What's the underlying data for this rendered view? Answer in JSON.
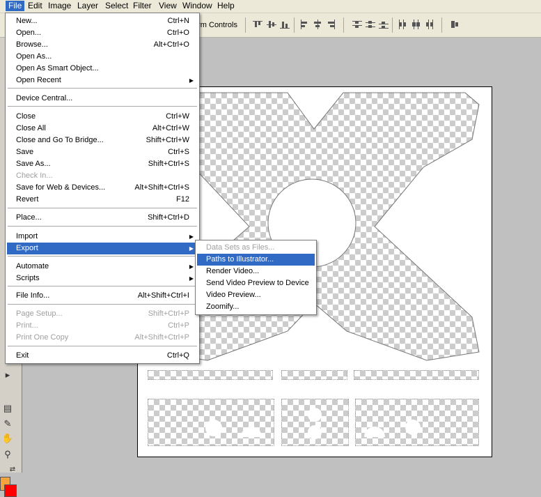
{
  "menubar": {
    "items": [
      {
        "label": "File",
        "active": true
      },
      {
        "label": "Edit"
      },
      {
        "label": "Image"
      },
      {
        "label": "Layer"
      },
      {
        "label": "Select"
      },
      {
        "label": "Filter"
      },
      {
        "label": "View"
      },
      {
        "label": "Window"
      },
      {
        "label": "Help"
      }
    ]
  },
  "options_bar": {
    "transform_controls_label": "orm Controls"
  },
  "file_menu": {
    "items": [
      {
        "label": "New...",
        "shortcut": "Ctrl+N"
      },
      {
        "label": "Open...",
        "shortcut": "Ctrl+O"
      },
      {
        "label": "Browse...",
        "shortcut": "Alt+Ctrl+O"
      },
      {
        "label": "Open As...",
        "shortcut": ""
      },
      {
        "label": "Open As Smart Object...",
        "shortcut": ""
      },
      {
        "label": "Open Recent",
        "shortcut": "",
        "submenu": true
      },
      {
        "label": "Device Central...",
        "shortcut": ""
      },
      {
        "label": "Close",
        "shortcut": "Ctrl+W"
      },
      {
        "label": "Close All",
        "shortcut": "Alt+Ctrl+W"
      },
      {
        "label": "Close and Go To Bridge...",
        "shortcut": "Shift+Ctrl+W"
      },
      {
        "label": "Save",
        "shortcut": "Ctrl+S"
      },
      {
        "label": "Save As...",
        "shortcut": "Shift+Ctrl+S"
      },
      {
        "label": "Check In...",
        "shortcut": "",
        "disabled": true
      },
      {
        "label": "Save for Web & Devices...",
        "shortcut": "Alt+Shift+Ctrl+S"
      },
      {
        "label": "Revert",
        "shortcut": "F12"
      },
      {
        "label": "Place...",
        "shortcut": "Shift+Ctrl+D"
      },
      {
        "label": "Import",
        "shortcut": "",
        "submenu": true
      },
      {
        "label": "Export",
        "shortcut": "",
        "submenu": true,
        "highlighted": true
      },
      {
        "label": "Automate",
        "shortcut": "",
        "submenu": true
      },
      {
        "label": "Scripts",
        "shortcut": "",
        "submenu": true
      },
      {
        "label": "File Info...",
        "shortcut": "Alt+Shift+Ctrl+I"
      },
      {
        "label": "Page Setup...",
        "shortcut": "Shift+Ctrl+P",
        "disabled": true
      },
      {
        "label": "Print...",
        "shortcut": "Ctrl+P",
        "disabled": true
      },
      {
        "label": "Print One Copy",
        "shortcut": "Alt+Shift+Ctrl+P",
        "disabled": true
      },
      {
        "label": "Exit",
        "shortcut": "Ctrl+Q"
      }
    ]
  },
  "export_submenu": {
    "items": [
      {
        "label": "Data Sets as Files...",
        "disabled": true
      },
      {
        "label": "Paths to Illustrator...",
        "highlighted": true
      },
      {
        "label": "Render Video..."
      },
      {
        "label": "Send Video Preview to Device"
      },
      {
        "label": "Video Preview..."
      },
      {
        "label": "Zoomify..."
      }
    ]
  },
  "colors": {
    "highlight": "#316ac5",
    "menubar_bg": "#ece9d8",
    "workspace_bg": "#c0c0c0",
    "foreground_swatch": "#f5a33c",
    "background_swatch": "#ff0000"
  }
}
